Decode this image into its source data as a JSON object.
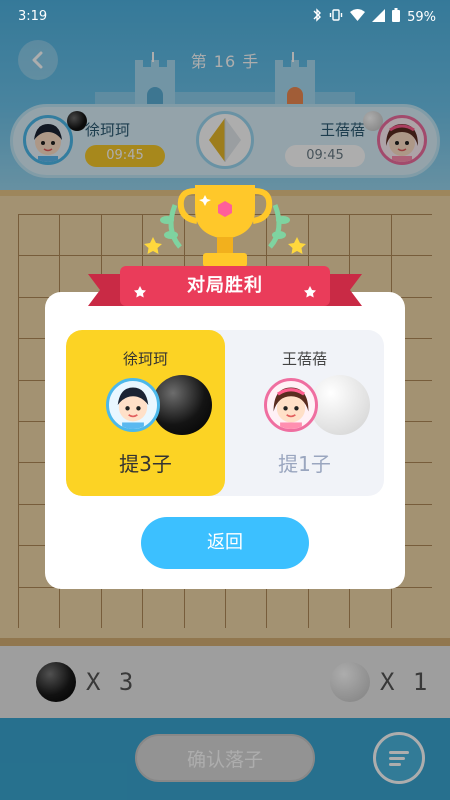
{
  "status_bar": {
    "time": "3:19",
    "battery": "59%"
  },
  "header": {
    "move_title": "第 16 手"
  },
  "players": {
    "left": {
      "name": "徐珂珂",
      "timer": "09:45",
      "stone": "black"
    },
    "right": {
      "name": "王蓓蓓",
      "timer": "09:45",
      "stone": "white"
    }
  },
  "board": {
    "size": 11
  },
  "captures": {
    "black_count": "X 3",
    "white_count": "X 1"
  },
  "footer": {
    "confirm_label": "确认落子"
  },
  "dialog": {
    "title": "对局胜利",
    "left": {
      "name": "徐珂珂",
      "capture_text": "提3子"
    },
    "right": {
      "name": "王蓓蓓",
      "capture_text": "提1子"
    },
    "return_label": "返回"
  },
  "colors": {
    "accent_blue": "#3cc0ff",
    "winner_yellow": "#fcd324",
    "ribbon_red": "#ea3c5a",
    "header_blue": "#4fb3e2"
  }
}
